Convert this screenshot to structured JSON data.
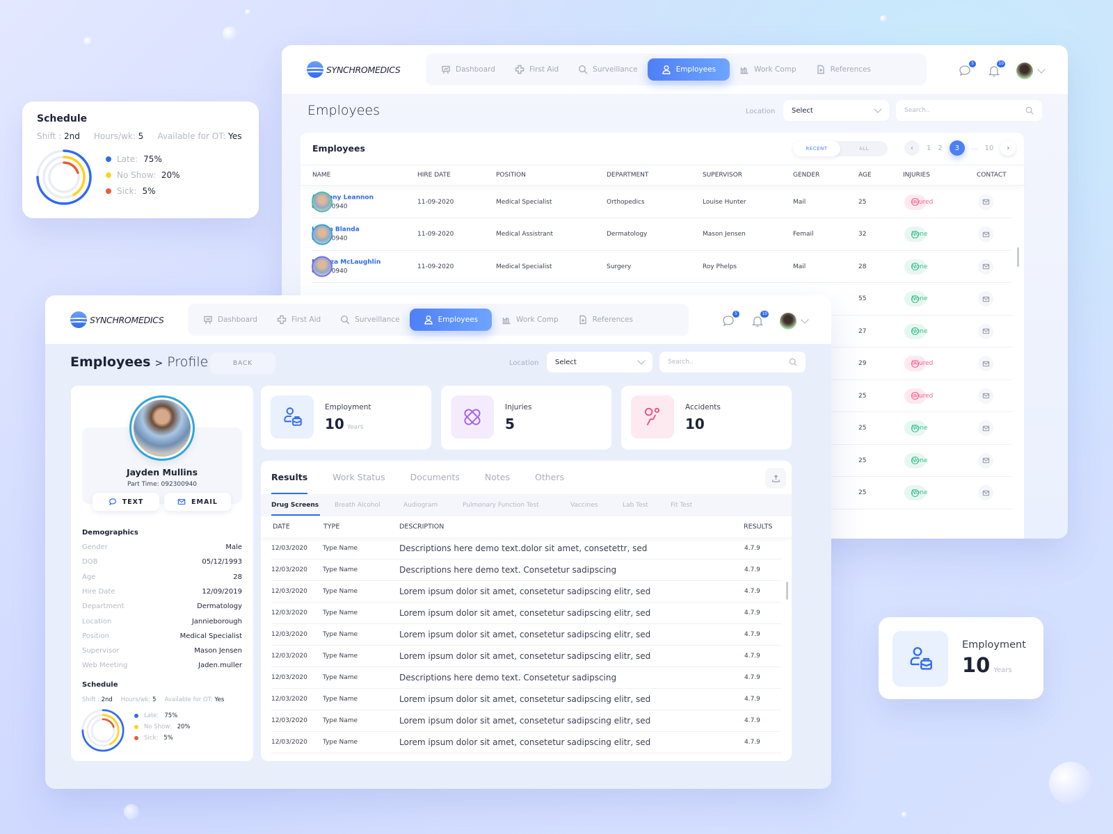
{
  "brand": "SYNCHROMEDICS",
  "nav": [
    {
      "label": "Dashboard",
      "icon": "presentation-chart-icon"
    },
    {
      "label": "First Aid",
      "icon": "medical-cross-icon"
    },
    {
      "label": "Surveillance",
      "icon": "search-icon"
    },
    {
      "label": "Employees",
      "icon": "user-icon",
      "active": true
    },
    {
      "label": "Work Comp",
      "icon": "bar-chart-icon"
    },
    {
      "label": "References",
      "icon": "document-plus-icon"
    }
  ],
  "header_icons": {
    "messages_badge": "5",
    "notifications_badge": "10"
  },
  "employees_page": {
    "title": "Employees",
    "location_label": "Location",
    "location_value": "Select",
    "search_placeholder": "Search..",
    "card_title": "Employees",
    "toggle": {
      "recent": "RECENT",
      "all": "ALL"
    },
    "pagination": {
      "pages": [
        "1",
        "2",
        "3"
      ],
      "current": "3",
      "ellipsis": "....",
      "last": "10"
    },
    "columns": [
      "NAME",
      "HIRE DATE",
      "POSITION",
      "DEPARTMENT",
      "SUPERVISOR",
      "GENDER",
      "AGE",
      "INJURIES",
      "CONTACT"
    ],
    "rows": [
      {
        "name": "Anthony Leannon",
        "id": "092300940",
        "hire_date": "11-09-2020",
        "position": "Medical Specialist",
        "department": "Orthopedics",
        "supervisor": "Louise Hunter",
        "gender": "Mail",
        "age": "25",
        "injuries": "Injured"
      },
      {
        "name": "Leann Blanda",
        "id": "092300940",
        "hire_date": "11-09-2020",
        "position": "Medical Assistrant",
        "department": "Dermatology",
        "supervisor": "Mason Jensen",
        "gender": "Femail",
        "age": "32",
        "injuries": "None"
      },
      {
        "name": "Maritza McLaughlin",
        "id": "092300940",
        "hire_date": "11-09-2020",
        "position": "Medical Specialist",
        "department": "Surgery",
        "supervisor": "Roy Phelps",
        "gender": "Mail",
        "age": "28",
        "injuries": "None"
      },
      {
        "age": "55",
        "injuries": "None"
      },
      {
        "age": "27",
        "injuries": "None"
      },
      {
        "age": "29",
        "injuries": "Injured"
      },
      {
        "age": "25",
        "injuries": "Injured"
      },
      {
        "age": "25",
        "injuries": "None"
      },
      {
        "age": "25",
        "injuries": "None"
      },
      {
        "age": "25",
        "injuries": "None"
      }
    ]
  },
  "schedule_float": {
    "title": "Schedule",
    "shift_label": "Shift :",
    "shift": "2nd",
    "hours_label": "Hours/wk:",
    "hours": "5",
    "ot_label": "Available for OT:",
    "ot": "Yes",
    "legend": [
      {
        "label": "Late:",
        "value": "75%",
        "percent": 75,
        "color": "#2f6af0"
      },
      {
        "label": "No Show:",
        "value": "20%",
        "percent": 20,
        "color": "#ffd21f"
      },
      {
        "label": "Sick:",
        "value": "5%",
        "percent": 5,
        "color": "#ee5a35"
      }
    ]
  },
  "profile_page": {
    "title_main": "Employees",
    "title_sep": ">",
    "title_sub": "Profile",
    "back_label": "BACK",
    "location_label": "Location",
    "location_value": "Select",
    "search_placeholder": "Search..",
    "person": {
      "name": "Jayden Mullins",
      "subtitle": "Part Time: 092300940",
      "text_label": "TEXT",
      "email_label": "EMAIL"
    },
    "demographics_title": "Demographics",
    "demographics": [
      {
        "k": "Gender",
        "v": "Male"
      },
      {
        "k": "DOB",
        "v": "05/12/1993"
      },
      {
        "k": "Age",
        "v": "28"
      },
      {
        "k": "Hire Date",
        "v": "12/09/2019"
      },
      {
        "k": "Department",
        "v": "Dermatology"
      },
      {
        "k": "Location",
        "v": "Jannieborough"
      },
      {
        "k": "Position",
        "v": "Medical Specialist"
      },
      {
        "k": "Supervisor",
        "v": "Mason Jensen"
      },
      {
        "k": "Web Meeting",
        "v": "Jaden.muller"
      }
    ],
    "schedule": {
      "title": "Schedule",
      "shift_label": "Shift :",
      "shift": "2nd",
      "hours_label": "Hours/wk:",
      "hours": "5",
      "ot_label": "Available for OT:",
      "ot": "Yes",
      "legend": [
        {
          "label": "Late:",
          "value": "75%"
        },
        {
          "label": "No Show:",
          "value": "20%"
        },
        {
          "label": "Sick:",
          "value": "5%"
        }
      ]
    },
    "stats": [
      {
        "label": "Employment",
        "value": "10",
        "unit": "Years",
        "color": "#2f6af0",
        "bg": "#e9f0fe"
      },
      {
        "label": "Injuries",
        "value": "5",
        "unit": "",
        "color": "#a55ee8",
        "bg": "#f4ecfd"
      },
      {
        "label": "Accidents",
        "value": "10",
        "unit": "",
        "color": "#f0507f",
        "bg": "#fdeaf0"
      }
    ],
    "tabs": [
      "Results",
      "Work Status",
      "Documents",
      "Notes",
      "Others"
    ],
    "subtabs": [
      "Drug Screens",
      "Breath Alcohol",
      "Audiogram",
      "Pulmonary Function Test",
      "Vaccines",
      "Lab Test",
      "Fit Test"
    ],
    "result_columns": [
      "DATE",
      "TYPE",
      "DESCRIPTION",
      "RESULTS"
    ],
    "results": [
      {
        "date": "12/03/2020",
        "type": "Type Name",
        "desc": "Descriptions here demo text.dolor sit amet, consetettr, sed",
        "result": "4.7.9"
      },
      {
        "date": "12/03/2020",
        "type": "Type Name",
        "desc": "Descriptions here demo text. Consetetur sadipscing",
        "result": "4.7.9"
      },
      {
        "date": "12/03/2020",
        "type": "Type Name",
        "desc": "Lorem ipsum dolor sit amet, consetetur sadipscing elitr, sed",
        "result": "4.7.9"
      },
      {
        "date": "12/03/2020",
        "type": "Type Name",
        "desc": "Lorem ipsum dolor sit amet, consetetur sadipscing elitr, sed",
        "result": "4.7.9"
      },
      {
        "date": "12/03/2020",
        "type": "Type Name",
        "desc": "Lorem ipsum dolor sit amet, consetetur sadipscing elitr, sed",
        "result": "4.7.9"
      },
      {
        "date": "12/03/2020",
        "type": "Type Name",
        "desc": "Lorem ipsum dolor sit amet, consetetur sadipscing elitr, sed",
        "result": "4.7.9"
      },
      {
        "date": "12/03/2020",
        "type": "Type Name",
        "desc": "Descriptions here demo text. Consetetur sadipscing",
        "result": "4.7.9"
      },
      {
        "date": "12/03/2020",
        "type": "Type Name",
        "desc": "Lorem ipsum dolor sit amet, consetetur sadipscing elitr, sed",
        "result": "4.7.9"
      },
      {
        "date": "12/03/2020",
        "type": "Type Name",
        "desc": "Lorem ipsum dolor sit amet, consetetur sadipscing elitr, sed",
        "result": "4.7.9"
      },
      {
        "date": "12/03/2020",
        "type": "Type Name",
        "desc": "Lorem ipsum dolor sit amet, consetetur sadipscing elitr, sed",
        "result": "4.7.9"
      }
    ]
  },
  "employment_float": {
    "label": "Employment",
    "value": "10",
    "unit": "Years"
  }
}
